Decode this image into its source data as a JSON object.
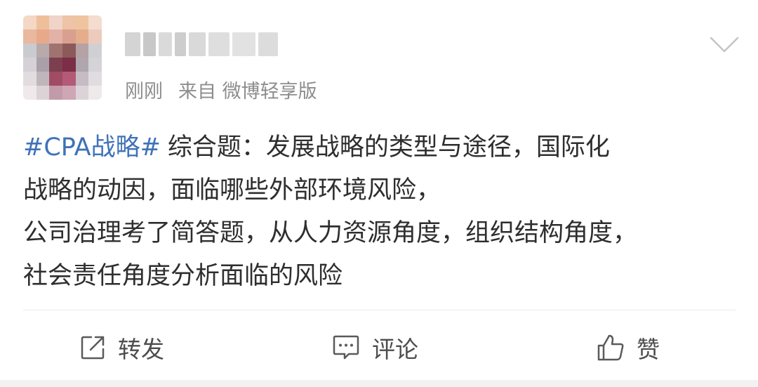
{
  "post": {
    "time": "刚刚",
    "source": "来自 微博轻享版",
    "topic": "#CPA战略#",
    "lines": [
      "综合题：发展战略的类型与途径，国际化",
      "战略的动因，面临哪些外部环境风险，",
      "公司治理考了简答题，从人力资源角度，组织结构角度，",
      "社会责任角度分析面临的风险"
    ]
  },
  "actions": {
    "repost": "转发",
    "comment": "评论",
    "like": "赞"
  },
  "icons": {
    "menu": "chevron-down-icon",
    "repost": "repost-icon",
    "comment": "comment-icon",
    "like": "thumbs-up-icon"
  },
  "colors": {
    "topic": "#3f72b8",
    "meta": "#8d8d8d",
    "text": "#2e2e2e",
    "action_text": "#4d4d4d"
  }
}
